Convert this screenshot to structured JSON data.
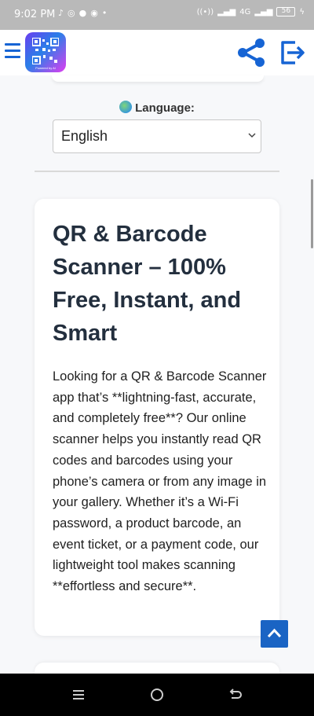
{
  "status_bar": {
    "time": "9:02 PM",
    "notification_icons": [
      "tiktok-icon",
      "whatsapp-icon",
      "chat-icon",
      "chrome-icon",
      "dot-icon"
    ],
    "network": "4G",
    "battery": "56"
  },
  "header": {
    "logo_caption": "Powered by AI",
    "icons": {
      "menu": "hamburger-icon",
      "share": "share-icon",
      "logout": "logout-icon"
    },
    "accent_color": "#1664d4"
  },
  "language": {
    "label": "Language:",
    "selected": "English"
  },
  "article": {
    "title": "QR & Barcode Scanner – 100% Free, Instant, and Smart",
    "body": "Looking for a QR & Barcode Scanner app that’s **lightning-fast, accurate, and completely free**? Our online scanner helps you instantly read QR codes and barcodes using your phone’s camera or from any image in your gallery. Whether it’s a Wi-Fi password, a product barcode, an event ticket, or a payment code, our lightweight tool makes scanning **effortless and secure**."
  },
  "scroll_top": {
    "icon": "chevron-up-icon",
    "color": "#1a64c4"
  },
  "nav_bar": {
    "icons": [
      "recent-apps-icon",
      "home-icon",
      "back-icon"
    ]
  }
}
